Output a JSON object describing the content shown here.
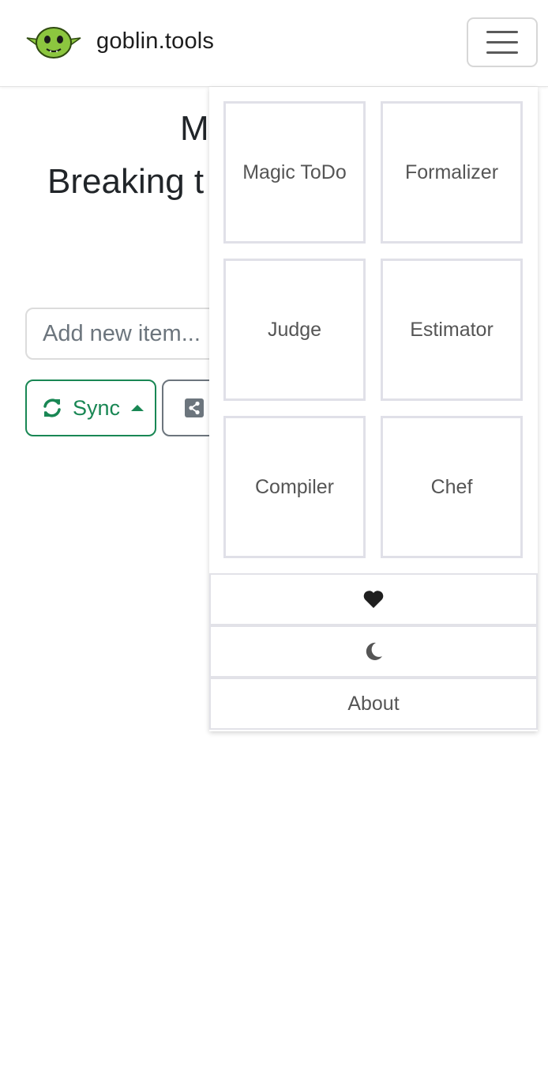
{
  "navbar": {
    "brand_text": "goblin.tools",
    "logo_icon": "goblin-logo-icon",
    "menu_icon": "hamburger-menu-icon"
  },
  "main": {
    "title_line1": "M",
    "title_line2": "Breaking t",
    "new_item_placeholder": "Add new item...",
    "sync_label": "Sync",
    "sync_icon": "sync-arrows-icon",
    "share_icon": "share-icon"
  },
  "menu": {
    "tools": [
      {
        "label": "Magic ToDo"
      },
      {
        "label": "Formalizer"
      },
      {
        "label": "Judge"
      },
      {
        "label": "Estimator"
      },
      {
        "label": "Compiler"
      },
      {
        "label": "Chef"
      }
    ],
    "support_icon": "heart-icon",
    "theme_icon": "moon-icon",
    "about_label": "About"
  },
  "colors": {
    "success": "#198754",
    "secondary": "#6c757d",
    "tile_border": "#e0e0e8",
    "goblin_green": "#8cc63f"
  }
}
